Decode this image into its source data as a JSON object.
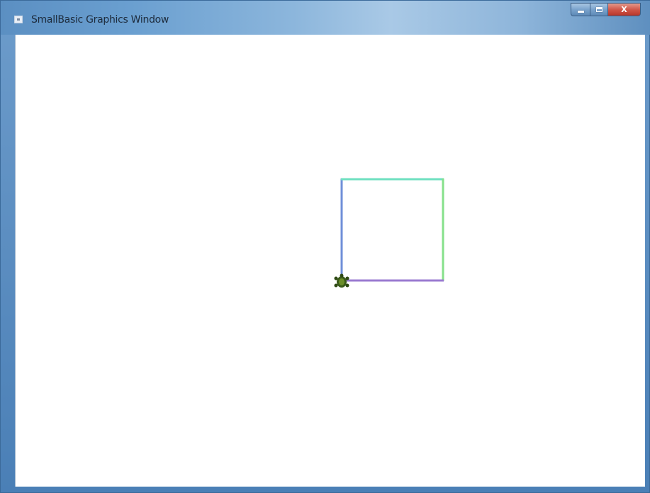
{
  "window": {
    "title": "SmallBasic Graphics Window",
    "controls": {
      "minimize": "minimize",
      "maximize": "maximize",
      "close": "X"
    }
  },
  "colors": {
    "left_edge": "#6f8fd8",
    "top_edge": "#6fe0c0",
    "right_edge": "#86e08a",
    "bottom_edge": "#9a7ad0",
    "turtle": "#3a5a1a"
  },
  "icons": [
    "app-icon",
    "minimize-icon",
    "maximize-icon",
    "close-icon",
    "turtle-icon"
  ]
}
